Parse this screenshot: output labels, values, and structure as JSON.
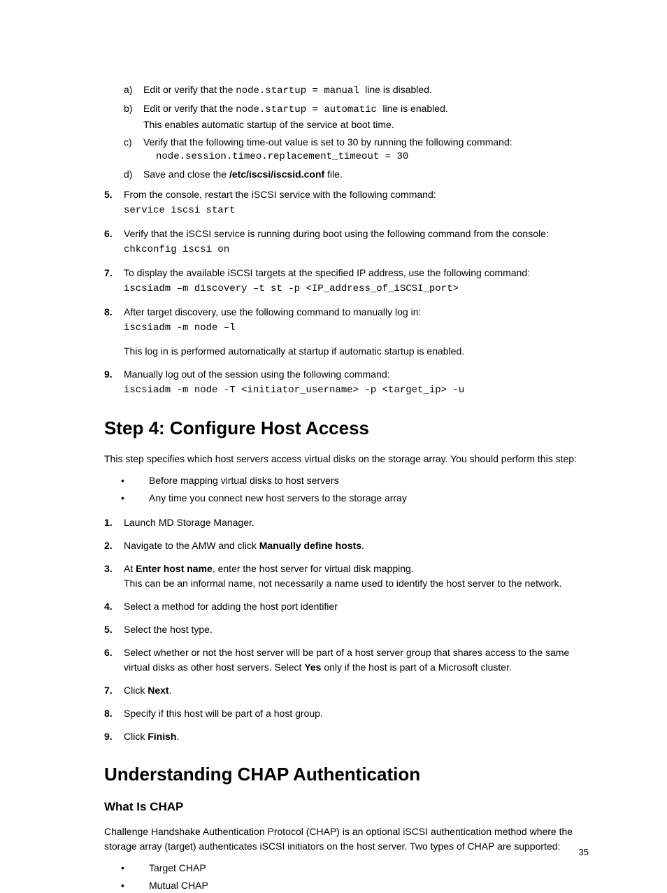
{
  "sublist": {
    "a": {
      "pre": "Edit or verify that the ",
      "code": " node.startup = manual ",
      "post": "line is disabled."
    },
    "b": {
      "pre": "Edit or verify that the ",
      "code": "node.startup = automatic ",
      "post": " line is enabled.",
      "extra": "This enables automatic startup of the service at boot time."
    },
    "c": {
      "text": "Verify that the following time-out value is set to 30 by running the following command:",
      "code": " node.session.timeo.replacement_timeout = 30"
    },
    "d": {
      "pre": "Save and close the ",
      "bold": "/etc/iscsi/iscsid.conf",
      "post": " file."
    }
  },
  "steps": {
    "s5": {
      "text": "From the console, restart the iSCSI service with the following command:",
      "code": "service iscsi start"
    },
    "s6": {
      "text": "Verify that the iSCSI service is running during boot using the following command from the console:",
      "code": "chkconfig iscsi on"
    },
    "s7": {
      "text": "To display the available iSCSI targets at the specified IP address, use the following command:",
      "code": "iscsiadm –m discovery –t st -p <IP_address_of_iSCSI_port>"
    },
    "s8": {
      "text": "After target discovery, use the following command to manually log in:",
      "code": "iscsiadm -m node –l",
      "extra": "This log in is performed automatically at startup if automatic startup is enabled."
    },
    "s9": {
      "text": "Manually log out of the session using the following command:",
      "code": "iscsiadm -m node -T <initiator_username> -p  <target_ip> -u"
    }
  },
  "heading_step4": "Step 4: Configure Host Access",
  "step4_intro": "This step specifies which host servers access virtual disks on the storage array. You should perform this step:",
  "step4_bullets": {
    "b1": "Before mapping virtual disks to host servers",
    "b2": "Any time you connect new host servers to the storage array"
  },
  "step4_list": {
    "n1": "Launch MD Storage Manager.",
    "n2": {
      "pre": "Navigate to the AMW and click ",
      "bold": "Manually define hosts",
      "post": "."
    },
    "n3": {
      "pre": "At ",
      "bold": "Enter host name",
      "post": ", enter the host server for virtual disk mapping.",
      "extra": "This can be an informal name, not necessarily a name used to identify the host server to the network."
    },
    "n4": "Select a method for adding the host port identifier",
    "n5": "Select the host type.",
    "n6": {
      "text": "Select whether or not the host server will be part of a host server group that shares access to the same virtual disks as other host servers. Select ",
      "bold": "Yes",
      "post": " only if the host is part of a Microsoft cluster."
    },
    "n7": {
      "pre": "Click ",
      "bold": "Next",
      "post": "."
    },
    "n8": "Specify if this host will be part of a host group.",
    "n9": {
      "pre": "Click ",
      "bold": "Finish",
      "post": "."
    }
  },
  "heading_chap": "Understanding CHAP Authentication",
  "heading_what": "What Is CHAP",
  "chap_para": "Challenge Handshake Authentication Protocol (CHAP) is an optional iSCSI authentication method where the storage array (target) authenticates iSCSI initiators on the host server. Two types of CHAP are supported:",
  "chap_bullets": {
    "b1": "Target CHAP",
    "b2": "Mutual CHAP"
  },
  "pagenum": "35"
}
